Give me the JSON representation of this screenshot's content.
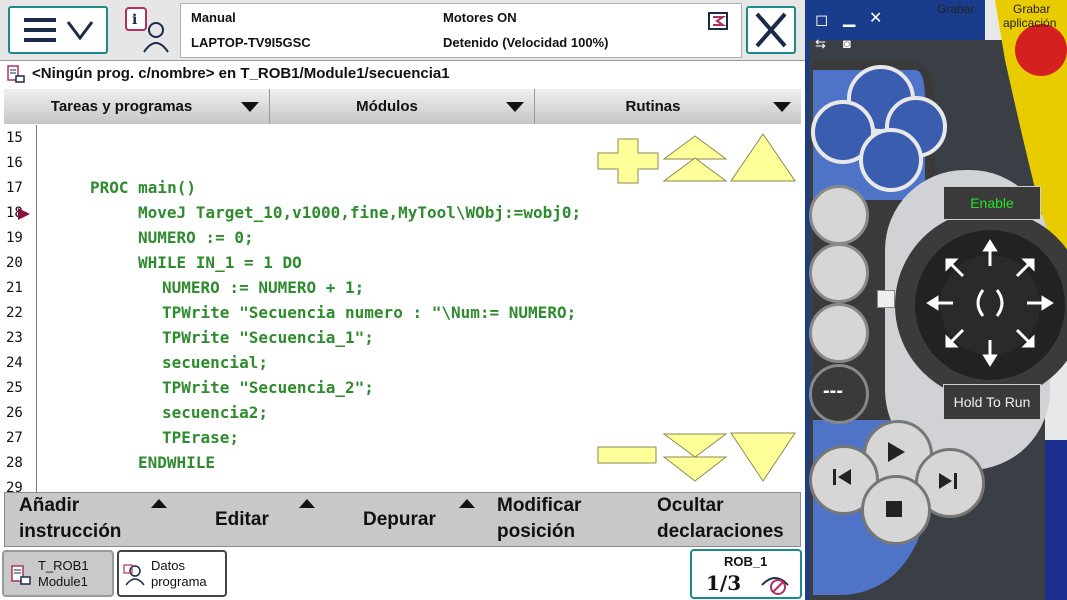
{
  "status": {
    "mode": "Manual",
    "system": "LAPTOP-TV9I5GSC",
    "motors": "Motores ON",
    "state": "Detenido (Velocidad 100%)"
  },
  "path": "<Ningún prog. c/nombre> en T_ROB1/Module1/secuencia1",
  "tabs": [
    "Tareas y programas",
    "Módulos",
    "Rutinas"
  ],
  "code": {
    "lines": [
      {
        "num": "15",
        "text": "",
        "indent": 0
      },
      {
        "num": "16",
        "text": "",
        "indent": 0
      },
      {
        "num": "17",
        "text": "PROC main()",
        "indent": 0
      },
      {
        "num": "18",
        "text": "MoveJ Target_10,v1000,fine,MyTool\\WObj:=wobj0;",
        "indent": 1
      },
      {
        "num": "19",
        "text": "NUMERO := 0;",
        "indent": 1
      },
      {
        "num": "20",
        "text": "WHILE IN_1 = 1 DO",
        "indent": 1
      },
      {
        "num": "21",
        "text": "NUMERO := NUMERO + 1;",
        "indent": 2
      },
      {
        "num": "22",
        "text": "TPWrite \"Secuencia numero : \"\\Num:= NUMERO;",
        "indent": 2
      },
      {
        "num": "23",
        "text": "TPWrite \"Secuencia_1\";",
        "indent": 2
      },
      {
        "num": "24",
        "text": "secuencial;",
        "indent": 2
      },
      {
        "num": "25",
        "text": "TPWrite \"Secuencia_2\";",
        "indent": 2
      },
      {
        "num": "26",
        "text": "secuencia2;",
        "indent": 2
      },
      {
        "num": "27",
        "text": "TPErase;",
        "indent": 2
      },
      {
        "num": "28",
        "text": "ENDWHILE",
        "indent": 1
      },
      {
        "num": "29",
        "text": "",
        "indent": 0
      }
    ],
    "pp_line": "18"
  },
  "commands": {
    "add_l1": "Añadir",
    "add_l2": "instrucción",
    "edit": "Editar",
    "debug": "Depurar",
    "modify_l1": "Modificar",
    "modify_l2": "posición",
    "hide_l1": "Ocultar",
    "hide_l2": "declaraciones"
  },
  "taskbar": {
    "task1_l1": "T_ROB1",
    "task1_l2": "Module1",
    "task2_l1": "Datos",
    "task2_l2": "programa",
    "robot": "ROB_1",
    "fraction": "1/3"
  },
  "pendant": {
    "enable": "Enable",
    "hold": "Hold To Run",
    "bg_text1": "Grabar",
    "bg_text2": "Grabar",
    "bg_text3": "aplicación"
  },
  "colors": {
    "accent": "#1d8a8a",
    "code": "#2e8b2e",
    "zoom": "#ffff99"
  }
}
